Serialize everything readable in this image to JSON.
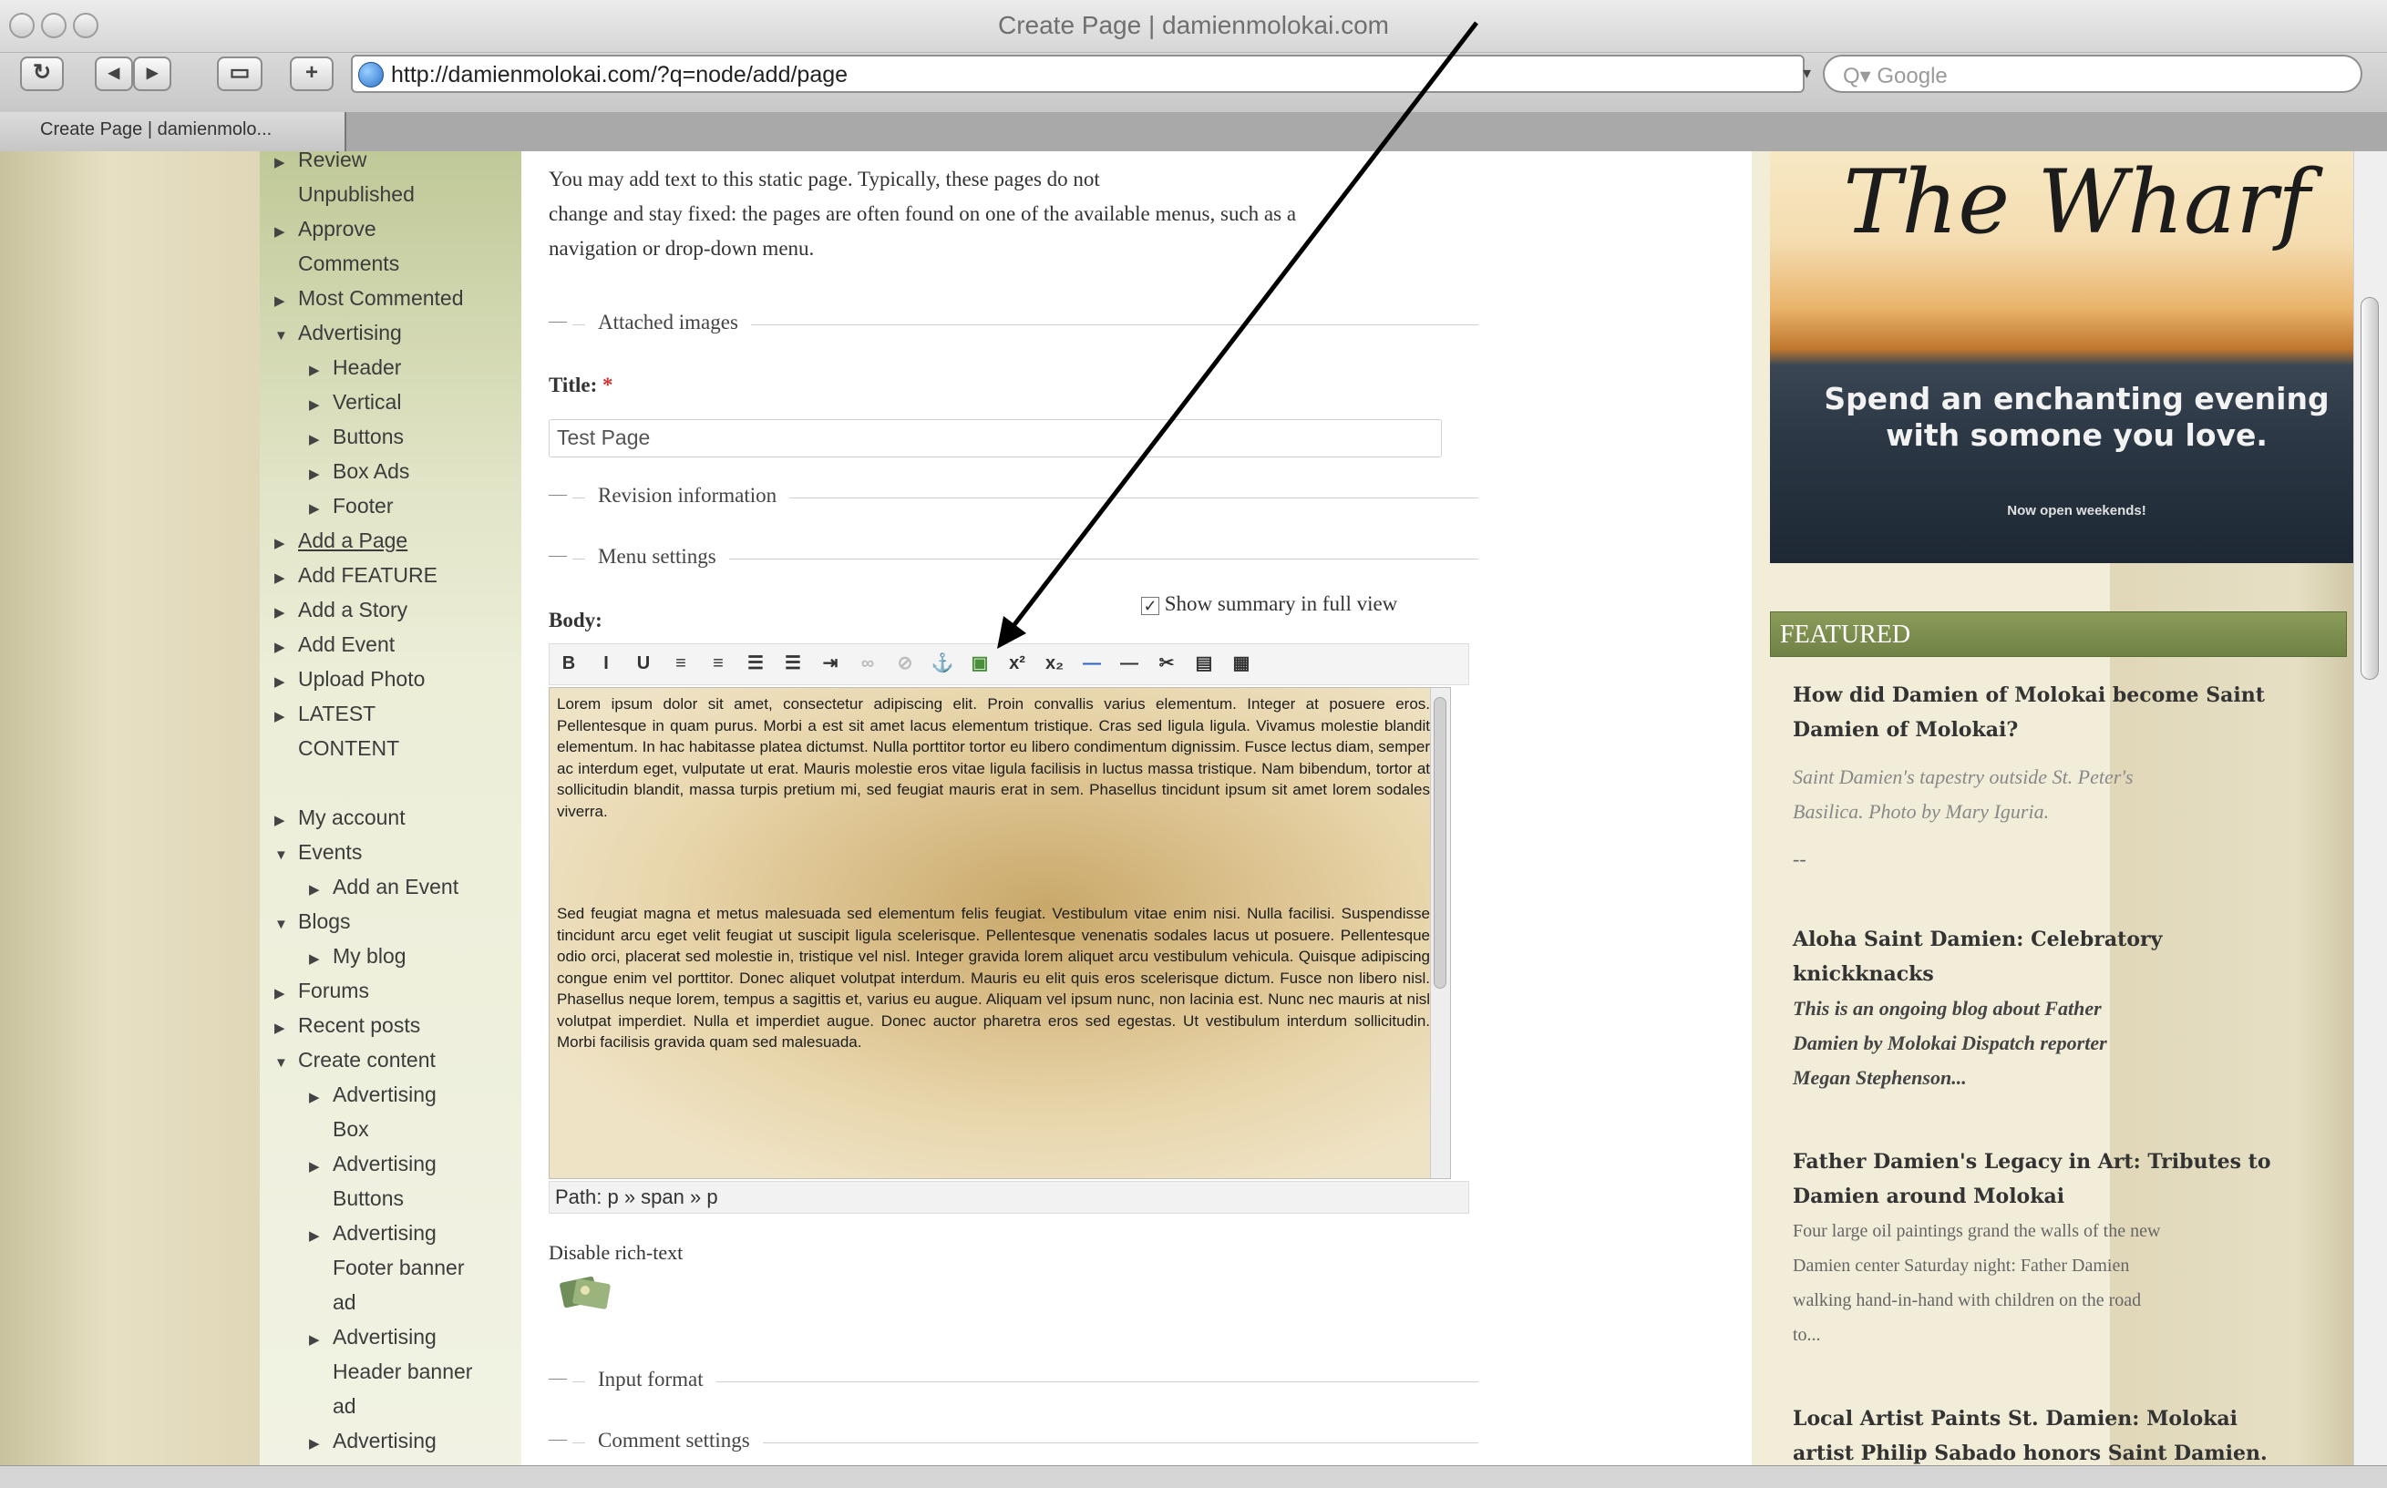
{
  "window": {
    "title": "Create Page | damienmolokai.com"
  },
  "toolbar": {
    "url": "http://damienmolokai.com/?q=node/add/page",
    "search_placeholder": "Q▾ Google",
    "tab_label": "Create Page | damienmolo..."
  },
  "sidebar": {
    "items": [
      {
        "label": "Review",
        "indent": 0,
        "arrow": "right"
      },
      {
        "label": "Unpublished",
        "indent": 0,
        "arrow": ""
      },
      {
        "label": "Approve",
        "indent": 0,
        "arrow": "right"
      },
      {
        "label": "Comments",
        "indent": 0,
        "arrow": ""
      },
      {
        "label": "Most Commented",
        "indent": 0,
        "arrow": "right"
      },
      {
        "label": "Advertising",
        "indent": 0,
        "arrow": "down"
      },
      {
        "label": "Header",
        "indent": 1,
        "arrow": "right"
      },
      {
        "label": "Vertical",
        "indent": 1,
        "arrow": "right"
      },
      {
        "label": "Buttons",
        "indent": 1,
        "arrow": "right"
      },
      {
        "label": "Box Ads",
        "indent": 1,
        "arrow": "right"
      },
      {
        "label": "Footer",
        "indent": 1,
        "arrow": "right"
      },
      {
        "label": "Add a Page",
        "indent": 0,
        "arrow": "right",
        "link": true
      },
      {
        "label": "Add FEATURE",
        "indent": 0,
        "arrow": "right"
      },
      {
        "label": "Add a Story",
        "indent": 0,
        "arrow": "right"
      },
      {
        "label": "Add Event",
        "indent": 0,
        "arrow": "right"
      },
      {
        "label": "Upload Photo",
        "indent": 0,
        "arrow": "right"
      },
      {
        "label": "LATEST",
        "indent": 0,
        "arrow": "right"
      },
      {
        "label": "CONTENT",
        "indent": 0,
        "arrow": ""
      },
      {
        "label": "",
        "indent": 0,
        "arrow": ""
      },
      {
        "label": "My account",
        "indent": 0,
        "arrow": "right"
      },
      {
        "label": "Events",
        "indent": 0,
        "arrow": "down"
      },
      {
        "label": "Add an Event",
        "indent": 1,
        "arrow": "right"
      },
      {
        "label": "Blogs",
        "indent": 0,
        "arrow": "down"
      },
      {
        "label": "My blog",
        "indent": 1,
        "arrow": "right"
      },
      {
        "label": "Forums",
        "indent": 0,
        "arrow": "right"
      },
      {
        "label": "Recent posts",
        "indent": 0,
        "arrow": "right"
      },
      {
        "label": "Create content",
        "indent": 0,
        "arrow": "down"
      },
      {
        "label": "Advertising",
        "indent": 1,
        "arrow": "right"
      },
      {
        "label": "Box",
        "indent": 1,
        "arrow": ""
      },
      {
        "label": "Advertising",
        "indent": 1,
        "arrow": "right"
      },
      {
        "label": "Buttons",
        "indent": 1,
        "arrow": ""
      },
      {
        "label": "Advertising",
        "indent": 1,
        "arrow": "right"
      },
      {
        "label": "Footer banner",
        "indent": 1,
        "arrow": ""
      },
      {
        "label": "ad",
        "indent": 1,
        "arrow": ""
      },
      {
        "label": "Advertising",
        "indent": 1,
        "arrow": "right"
      },
      {
        "label": "Header banner",
        "indent": 1,
        "arrow": ""
      },
      {
        "label": "ad",
        "indent": 1,
        "arrow": ""
      },
      {
        "label": "Advertising",
        "indent": 1,
        "arrow": "right"
      }
    ]
  },
  "main": {
    "intro_line1": "You may add text to this static page. Typically, these pages do not",
    "intro_line2": "change and stay fixed: the pages are often found on one of the available menus, such as a",
    "intro_line3": "navigation or drop-down menu.",
    "attached_images": "Attached images",
    "title_label": "Title:",
    "title_required": "*",
    "title_value": "Test Page",
    "revision_information": "Revision information",
    "menu_settings": "Menu settings",
    "show_summary": "Show summary in full view",
    "body_label": "Body:",
    "editor_para1": "Lorem ipsum dolor sit amet, consectetur adipiscing elit. Proin convallis varius elementum. Integer at posuere eros. Pellentesque in quam purus. Morbi a est sit amet lacus elementum tristique. Cras sed ligula ligula. Vivamus molestie blandit elementum. In hac habitasse platea dictumst. Nulla porttitor tortor eu libero condimentum dignissim. Fusce lectus diam, semper ac interdum eget, vulputate ut erat. Mauris molestie eros vitae ligula facilisis in luctus massa tristique. Nam bibendum, tortor at sollicitudin blandit, massa turpis pretium mi, sed feugiat mauris erat in sem. Phasellus tincidunt ipsum sit amet lorem sodales viverra.",
    "editor_para2": "Sed feugiat magna et metus malesuada sed elementum felis feugiat. Vestibulum vitae enim nisi. Nulla facilisi. Suspendisse tincidunt arcu eget velit feugiat ut suscipit ligula scelerisque. Pellentesque venenatis sodales lacus ut posuere. Pellentesque odio orci, placerat sed molestie in, tristique vel nisl. Integer gravida lorem aliquet arcu vestibulum vehicula. Quisque adipiscing congue enim vel porttitor. Donec aliquet volutpat interdum. Mauris eu elit quis eros scelerisque dictum. Fusce non libero nisl. Phasellus neque lorem, tempus a sagittis et, varius eu augue. Aliquam vel ipsum nunc, non lacinia est. Nunc nec mauris at nisl volutpat imperdiet. Nulla et imperdiet augue. Donec auctor pharetra eros sed egestas. Ut vestibulum interdum sollicitudin. Morbi facilisis gravida quam sed malesuada.",
    "path_text": "Path: p » span » p",
    "disable_rich_text": "Disable rich-text",
    "input_format": "Input format",
    "comment_settings": "Comment settings",
    "editor_buttons": [
      "B",
      "I",
      "U",
      "≡",
      "≡",
      "☰",
      "☰",
      "⇥",
      "∞",
      "⊘",
      "⚓",
      "▣",
      "x²",
      "x₂",
      "—",
      "—",
      "✂",
      "▤",
      "▦"
    ]
  },
  "right": {
    "ad_title": "The Wharf",
    "ad_line1": "Spend an enchanting evening",
    "ad_line2": "with somone you love.",
    "ad_line3": "Now open weekends!",
    "featured_header": "FEATURED",
    "item1_title_l1": "How did Damien of Molokai become Saint",
    "item1_title_l2": "Damien of Molokai?",
    "item1_sub_l1": "Saint Damien's tapestry outside St. Peter's",
    "item1_sub_l2": "Basilica. Photo by Mary Iguria.",
    "item1_dash": "--",
    "item2_title_l1": "Aloha Saint Damien: Celebratory",
    "item2_title_l2": "knickknacks",
    "item2_sub_l1": "This is an ongoing blog about Father",
    "item2_sub_l2": "Damien by Molokai Dispatch reporter",
    "item2_sub_l3": "Megan Stephenson...",
    "item3_title_l1": "Father Damien's Legacy in Art: Tributes to",
    "item3_title_l2": "Damien around Molokai",
    "item3_sub_l1": "Four large oil paintings grand the walls of the new",
    "item3_sub_l2": "Damien center Saturday night: Father Damien",
    "item3_sub_l3": "walking hand-in-hand with children on the road",
    "item3_sub_l4": "to...",
    "item4_title_l1": "Local Artist Paints St. Damien: Molokai",
    "item4_title_l2": "artist Philip Sabado honors Saint Damien."
  }
}
